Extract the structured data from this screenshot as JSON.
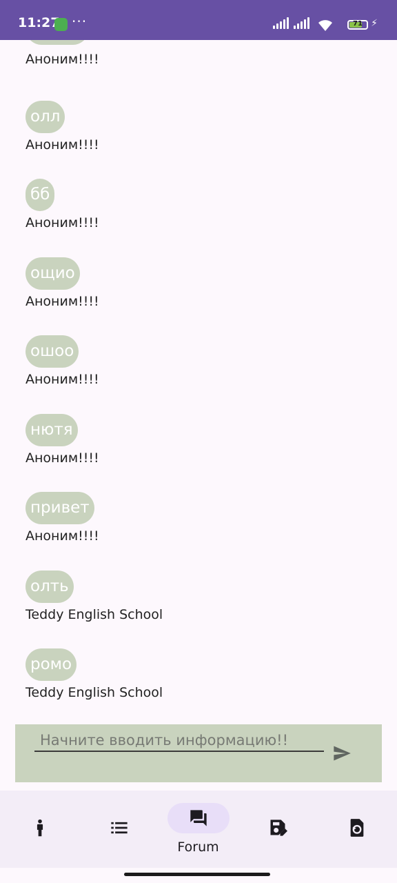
{
  "status_bar": {
    "time": "11:27",
    "battery_level": "71",
    "icons": [
      "app-notification-icon",
      "more-dots-icon",
      "signal-icon",
      "signal-r-icon",
      "wifi-icon",
      "battery-icon",
      "charging-bolt-icon"
    ]
  },
  "messages": [
    {
      "text": "",
      "author": "Аноним!!!!"
    },
    {
      "text": "олл",
      "author": "Аноним!!!!"
    },
    {
      "text": "бб",
      "author": "Аноним!!!!"
    },
    {
      "text": "ощио",
      "author": "Аноним!!!!"
    },
    {
      "text": "ошоо",
      "author": "Аноним!!!!"
    },
    {
      "text": "нютя",
      "author": "Аноним!!!!"
    },
    {
      "text": "привет",
      "author": "Аноним!!!!"
    },
    {
      "text": "олть",
      "author": "Teddy English School"
    },
    {
      "text": "ромо",
      "author": "Teddy English School"
    }
  ],
  "composer": {
    "value": "",
    "placeholder": "Начните вводить информацию!!",
    "send_icon": "send-icon"
  },
  "bottom_nav": {
    "items": [
      {
        "icon": "person-icon",
        "label": "",
        "active": false
      },
      {
        "icon": "list-icon",
        "label": "",
        "active": false
      },
      {
        "icon": "forum-icon",
        "label": "Forum",
        "active": true
      },
      {
        "icon": "save-edit-icon",
        "label": "",
        "active": false
      },
      {
        "icon": "restore-file-icon",
        "label": "",
        "active": false
      }
    ]
  },
  "colors": {
    "status_bar": "#6750a4",
    "bubble": "#c9d3be",
    "background": "#fdf8fd",
    "nav_background": "#f3edf7",
    "nav_active_pill": "#e8def8"
  }
}
